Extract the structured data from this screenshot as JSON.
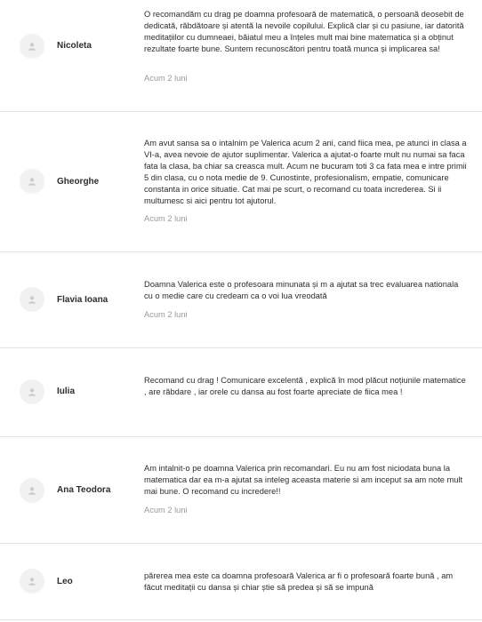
{
  "reviews": [
    {
      "name": "Nicoleta",
      "text": "O recomandăm cu drag pe doamna profesoară de matematică, o persoană deosebit de dedicată, răbdătoare și atentă la nevoile copilului. Explică clar și cu pasiune, iar datorită meditațiilor cu dumneaei, băiatul meu a înțeles mult mai bine matematica și a obținut rezultate foarte bune. Suntem recunoscători pentru toată munca și implicarea sa!",
      "time": "Acum 2 luni",
      "avatar_icon": "user-icon"
    },
    {
      "name": "Gheorghe",
      "text": "Am avut sansa sa o intalnim pe Valerica acum 2 ani, cand fiica mea, pe atunci in clasa a VI-a, avea nevoie de ajutor suplimentar. Valerica a ajutat-o foarte mult nu numai sa faca fata la clasa, ba chiar sa creasca mult. Acum ne bucuram toti 3 ca fata mea e intre primii 5 din clasa, cu o nota medie de 9. Cunostinte, profesionalism, empatie, comunicare constanta in orice situatie. Cat mai pe scurt, o recomand cu toata increderea. Si ii multumesc si aici pentru tot ajutorul.",
      "time": "Acum 2 luni",
      "avatar_icon": "user-icon"
    },
    {
      "name": "Flavia Ioana",
      "text": "Doamna Valerica este o profesoara minunata și m a ajutat sa trec evaluarea nationala cu o medie care cu credeam ca o voi lua vreodată",
      "time": "Acum 2 luni",
      "avatar_icon": "user-icon"
    },
    {
      "name": "Iulia",
      "text": "Recomand cu drag ! Comunicare excelentă , explică în mod plăcut noțiunile matematice , are răbdare , iar orele cu dansa au fost foarte apreciate de fiica mea !",
      "time": "",
      "avatar_icon": "user-icon"
    },
    {
      "name": "Ana Teodora",
      "text": "Am intalnit-o pe doamna Valerica prin recomandari. Eu nu am fost niciodata buna la matematica dar ea m-a ajutat sa inteleg aceasta materie si am inceput sa am note mult mai bune. O recomand cu incredere!!",
      "time": "Acum 2 luni",
      "avatar_icon": "user-icon"
    },
    {
      "name": "Leo",
      "text": "părerea mea este ca doamna profesoară Valerica ar fi o profesoară foarte bună , am făcut meditații cu dansa și chiar știe să predea și să se impună",
      "time": "",
      "avatar_icon": "user-icon"
    }
  ]
}
